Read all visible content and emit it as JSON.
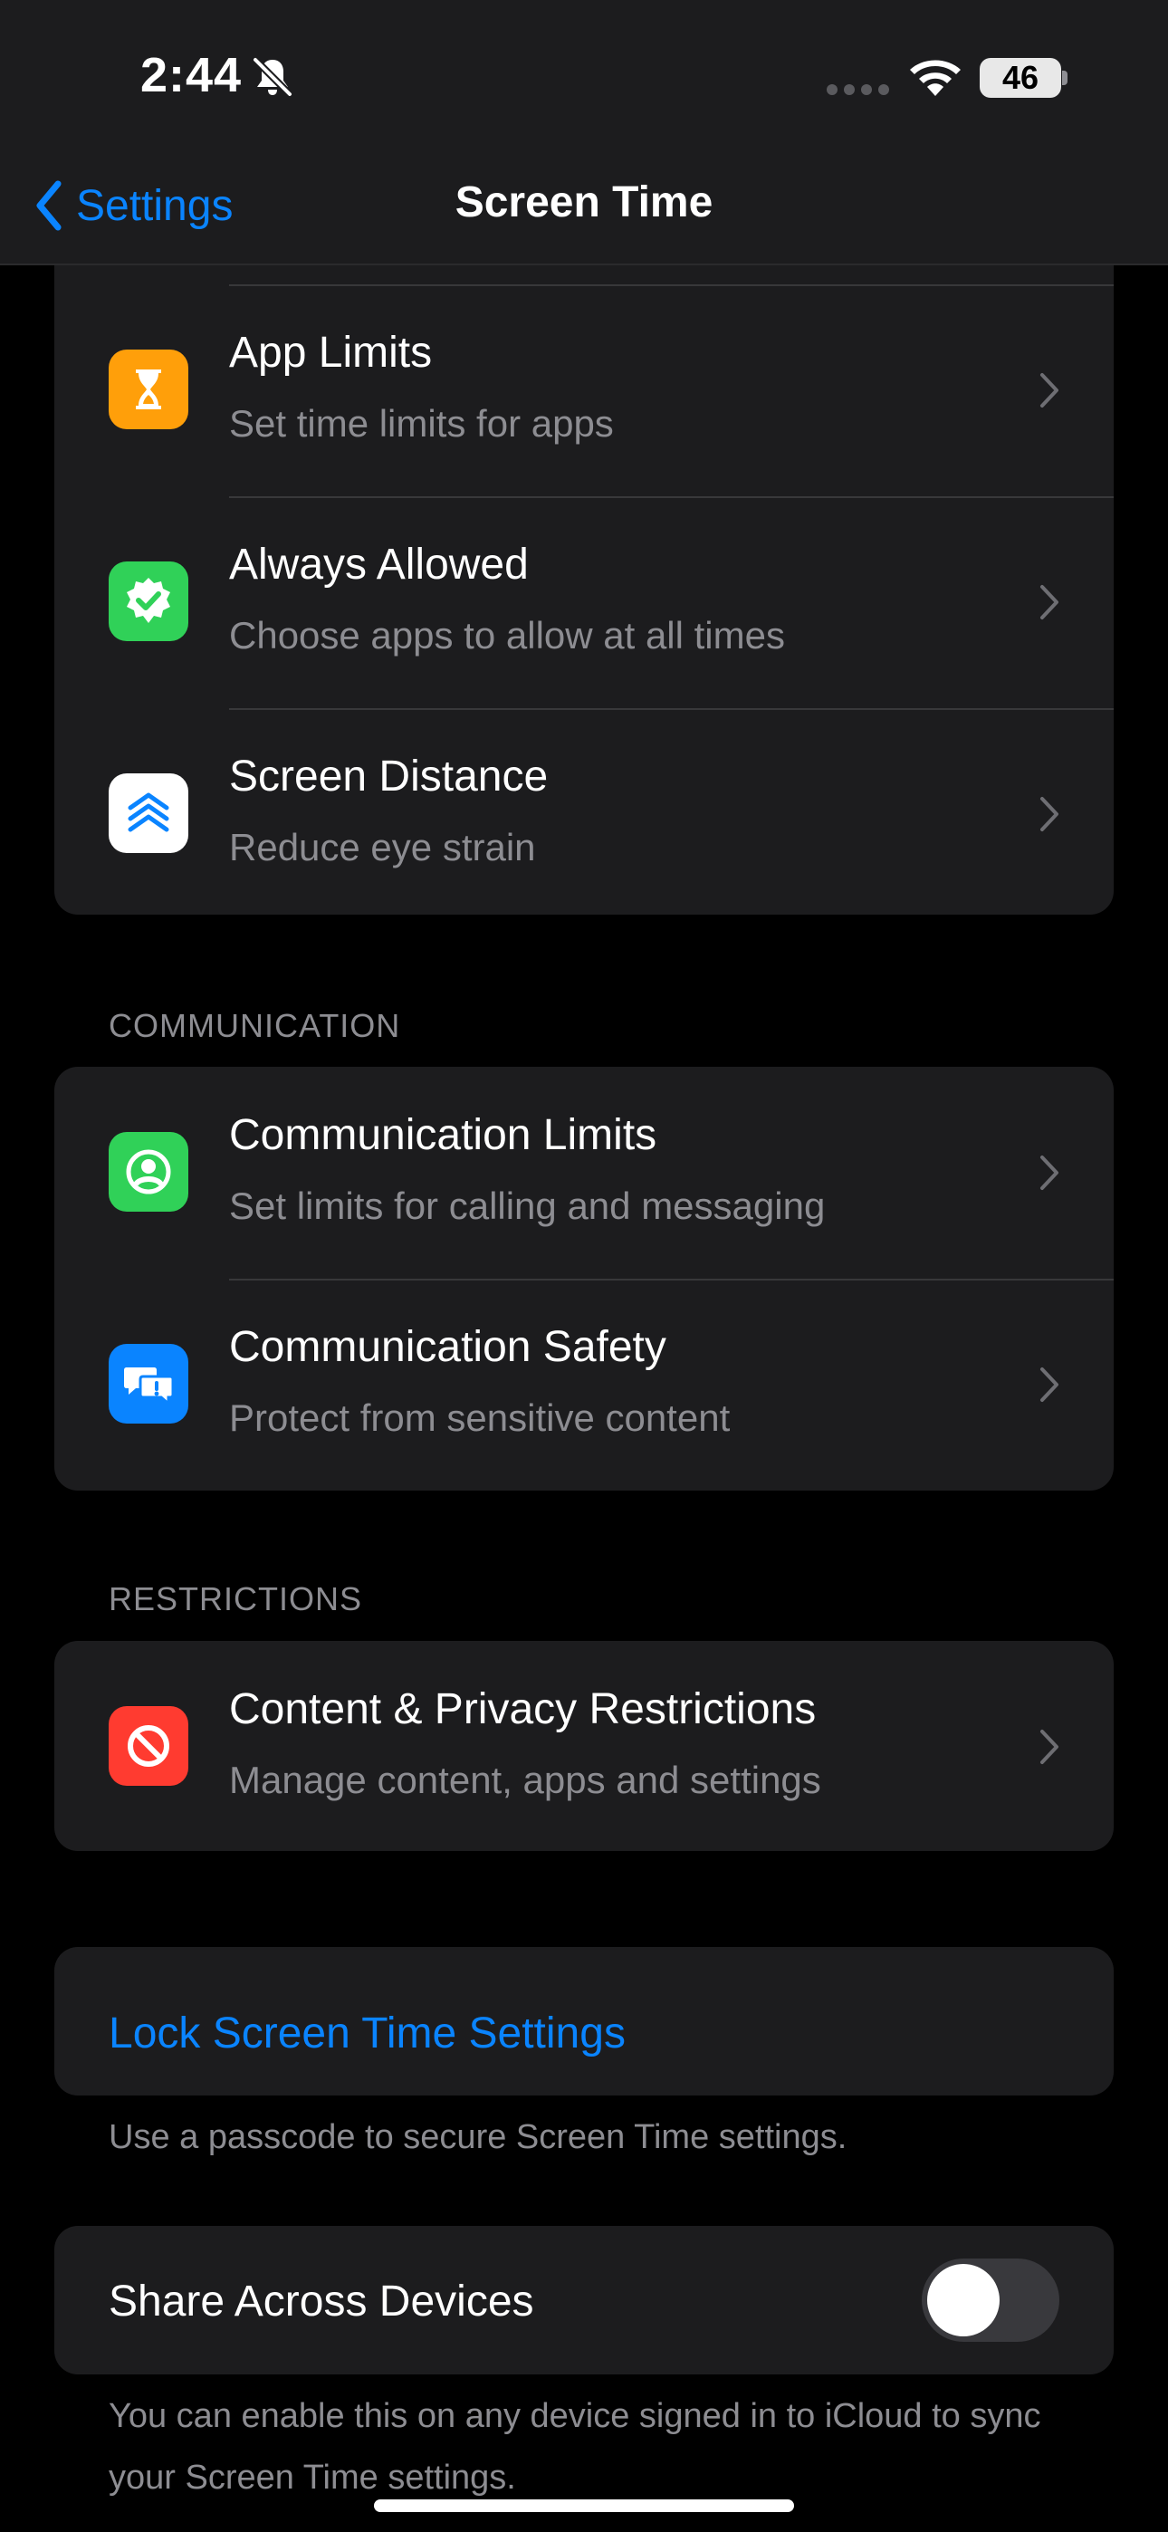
{
  "status_bar": {
    "time": "2:44",
    "battery": "46"
  },
  "nav": {
    "back_label": "Settings",
    "title": "Screen Time"
  },
  "groups": {
    "limits": [
      {
        "title": "App Limits",
        "subtitle": "Set time limits for apps",
        "icon": "hourglass-icon",
        "color": "#ff9f0a"
      },
      {
        "title": "Always Allowed",
        "subtitle": "Choose apps to allow at all times",
        "icon": "checkmark-badge-icon",
        "color": "#30d158"
      },
      {
        "title": "Screen Distance",
        "subtitle": "Reduce eye strain",
        "icon": "chevrons-up-icon",
        "color": "#ffffff"
      }
    ],
    "communication_header": "COMMUNICATION",
    "communication": [
      {
        "title": "Communication Limits",
        "subtitle": "Set limits for calling and messaging",
        "icon": "person-circle-icon",
        "color": "#30d158"
      },
      {
        "title": "Communication Safety",
        "subtitle": "Protect from sensitive content",
        "icon": "chat-bubble-alert-icon",
        "color": "#0a84ff"
      }
    ],
    "restrictions_header": "RESTRICTIONS",
    "restrictions": [
      {
        "title": "Content & Privacy Restrictions",
        "subtitle": "Manage content, apps and settings",
        "icon": "no-entry-icon",
        "color": "#ff3b30"
      }
    ]
  },
  "lock": {
    "label": "Lock Screen Time Settings",
    "footer": "Use a passcode to secure Screen Time settings."
  },
  "share": {
    "label": "Share Across Devices",
    "enabled": false,
    "footer": "You can enable this on any device signed in to iCloud to sync your Screen Time settings."
  },
  "colors": {
    "accent": "#0a84ff",
    "background": "#000000",
    "cell": "#1c1c1e"
  }
}
